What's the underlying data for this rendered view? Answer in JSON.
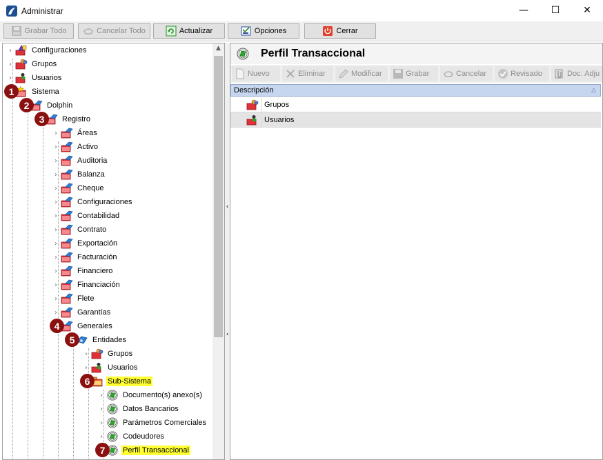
{
  "window": {
    "title": "Administrar",
    "minimize": "—",
    "maximize": "☐",
    "close": "✕"
  },
  "toolbar": {
    "grabar_todo": "Grabar Todo",
    "cancelar_todo": "Cancelar Todo",
    "actualizar": "Actualizar",
    "opciones": "Opciones",
    "cerrar": "Cerrar"
  },
  "tree": {
    "items": [
      {
        "label": "Configuraciones",
        "icon": "configuraciones-icon"
      },
      {
        "label": "Grupos",
        "icon": "grupos-icon"
      },
      {
        "label": "Usuarios",
        "icon": "usuarios-icon"
      },
      {
        "label": "Sistema",
        "icon": "sistema-folder-icon"
      },
      {
        "label": "Dolphin",
        "icon": "dolphin-folder-icon"
      },
      {
        "label": "Registro",
        "icon": "registro-folder-icon"
      },
      {
        "label": "Áreas",
        "icon": "folder-icon"
      },
      {
        "label": "Activo",
        "icon": "folder-icon"
      },
      {
        "label": "Auditoria",
        "icon": "folder-icon"
      },
      {
        "label": "Balanza",
        "icon": "folder-icon"
      },
      {
        "label": "Cheque",
        "icon": "folder-icon"
      },
      {
        "label": "Configuraciones",
        "icon": "folder-icon"
      },
      {
        "label": "Contabilidad",
        "icon": "folder-icon"
      },
      {
        "label": "Contrato",
        "icon": "folder-icon"
      },
      {
        "label": "Exportación",
        "icon": "folder-icon"
      },
      {
        "label": "Facturación",
        "icon": "folder-icon"
      },
      {
        "label": "Financiero",
        "icon": "folder-icon"
      },
      {
        "label": "Financiación",
        "icon": "folder-icon"
      },
      {
        "label": "Flete",
        "icon": "folder-icon"
      },
      {
        "label": "Garantías",
        "icon": "folder-icon"
      },
      {
        "label": "Generales",
        "icon": "folder-icon"
      },
      {
        "label": "Entidades",
        "icon": "entidades-icon"
      },
      {
        "label": "Grupos",
        "icon": "grupos-icon"
      },
      {
        "label": "Usuarios",
        "icon": "usuarios-icon"
      },
      {
        "label": "Sub-Sistema",
        "icon": "subsistema-folder-icon"
      },
      {
        "label": "Documento(s) anexo(s)",
        "icon": "green-leaf-icon"
      },
      {
        "label": "Datos Bancarios",
        "icon": "green-leaf-icon"
      },
      {
        "label": "Parámetros Comerciales",
        "icon": "green-leaf-icon"
      },
      {
        "label": "Codeudores",
        "icon": "green-leaf-icon"
      },
      {
        "label": "Perfil Transaccional",
        "icon": "green-leaf-icon"
      }
    ],
    "badges": [
      "1",
      "2",
      "3",
      "4",
      "5",
      "6",
      "7"
    ]
  },
  "detail": {
    "title": "Perfil Transaccional",
    "toolbar": {
      "nuevo": "Nuevo",
      "eliminar": "Eliminar",
      "modificar": "Modificar",
      "grabar": "Grabar",
      "cancelar": "Cancelar",
      "revisado": "Revisado",
      "doc_adjuntos": "Doc. Adju"
    },
    "grid": {
      "column_header": "Descripción",
      "rows": [
        {
          "label": "Grupos",
          "icon": "grupos-icon"
        },
        {
          "label": "Usuarios",
          "icon": "usuarios-icon"
        }
      ]
    }
  },
  "colors": {
    "badge": "#8b1010",
    "highlight": "#ffff33",
    "grid_header": "#c5d6ee",
    "folder_red": "#e0303a",
    "leaf_green": "#2aa52a"
  }
}
